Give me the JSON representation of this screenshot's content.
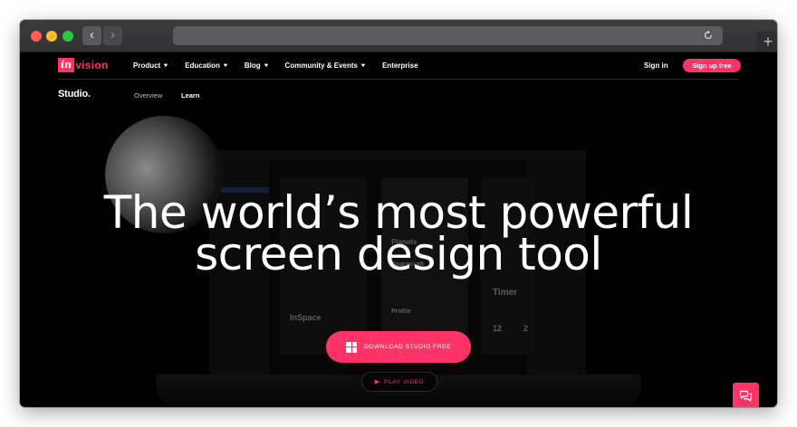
{
  "browser": {
    "back_glyph": "‹",
    "forward_glyph": "›",
    "reload_icon": "reload-icon",
    "new_tab_glyph": "+"
  },
  "header": {
    "logo_in": "in",
    "logo_text": "vision",
    "nav": [
      {
        "label": "Product",
        "dropdown": true
      },
      {
        "label": "Education",
        "dropdown": true
      },
      {
        "label": "Blog",
        "dropdown": true
      },
      {
        "label": "Community & Events",
        "dropdown": true
      },
      {
        "label": "Enterprise",
        "dropdown": false
      }
    ],
    "sign_in": "Sign in",
    "sign_up": "Sign up free"
  },
  "subnav": {
    "brand": "Studio.",
    "overview": "Overview",
    "learn": "Learn"
  },
  "mockup": {
    "frame1_title": "InSpace",
    "frame2_title": "Planets",
    "frame2_sub": "Spacecraft",
    "frame2_profile": "Profile",
    "frame3_title": "Timer",
    "frame3_n1": "12",
    "frame3_n2": "2"
  },
  "hero": {
    "headline_line1": "The world’s most powerful",
    "headline_line2": "screen design tool",
    "download_label": "DOWNLOAD STUDIO FREE",
    "play_label": "PLAY VIDEO"
  },
  "colors": {
    "accent": "#ff3366",
    "background": "#000000"
  },
  "icons": {
    "download": "windows-icon",
    "play": "play-icon",
    "chat": "chat-icon"
  }
}
